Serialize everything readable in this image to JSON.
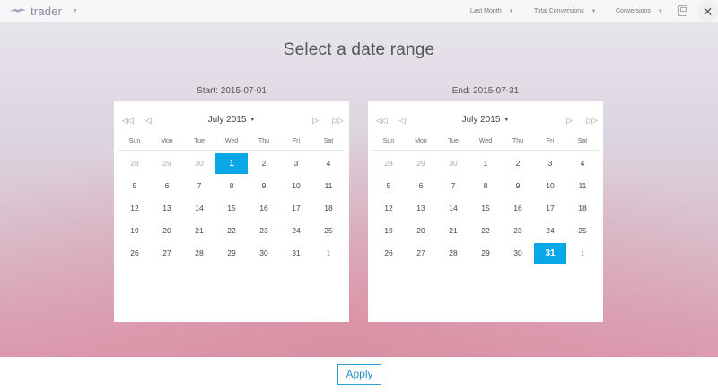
{
  "app": {
    "logo_text": "trader",
    "menus": [
      {
        "label": "Last Month"
      },
      {
        "label": "Total Conversions"
      },
      {
        "label": "Conversions"
      }
    ]
  },
  "dialog": {
    "title": "Select a date range",
    "close_label": "×",
    "apply_label": "Apply",
    "selection_color": "#0aa7e6"
  },
  "start": {
    "label": "Start: 2015-07-01",
    "month_label": "July 2015",
    "nav": {
      "prev_year": "◁◁",
      "prev_month": "◁",
      "next_month": "▷",
      "next_year": "▷▷"
    },
    "weekdays": [
      "Sun",
      "Mon",
      "Tue",
      "Wed",
      "Thu",
      "Fri",
      "Sat"
    ],
    "weeks": [
      [
        "28",
        "29",
        "30",
        "1",
        "2",
        "3",
        "4"
      ],
      [
        "5",
        "6",
        "7",
        "8",
        "9",
        "10",
        "11"
      ],
      [
        "12",
        "13",
        "14",
        "15",
        "16",
        "17",
        "18"
      ],
      [
        "19",
        "20",
        "21",
        "22",
        "23",
        "24",
        "25"
      ],
      [
        "26",
        "27",
        "28",
        "29",
        "30",
        "31",
        "1"
      ]
    ],
    "selected_day": "1"
  },
  "end": {
    "label": "End: 2015-07-31",
    "month_label": "July 2015",
    "nav": {
      "prev_year": "◁◁",
      "prev_month": "◁",
      "next_month": "▷",
      "next_year": "▷▷"
    },
    "weekdays": [
      "Sun",
      "Mon",
      "Tue",
      "Wed",
      "Thu",
      "Fri",
      "Sat"
    ],
    "weeks": [
      [
        "28",
        "29",
        "30",
        "1",
        "2",
        "3",
        "4"
      ],
      [
        "5",
        "6",
        "7",
        "8",
        "9",
        "10",
        "11"
      ],
      [
        "12",
        "13",
        "14",
        "15",
        "16",
        "17",
        "18"
      ],
      [
        "19",
        "20",
        "21",
        "22",
        "23",
        "24",
        "25"
      ],
      [
        "26",
        "27",
        "28",
        "29",
        "30",
        "31",
        "1"
      ]
    ],
    "selected_day": "31"
  }
}
